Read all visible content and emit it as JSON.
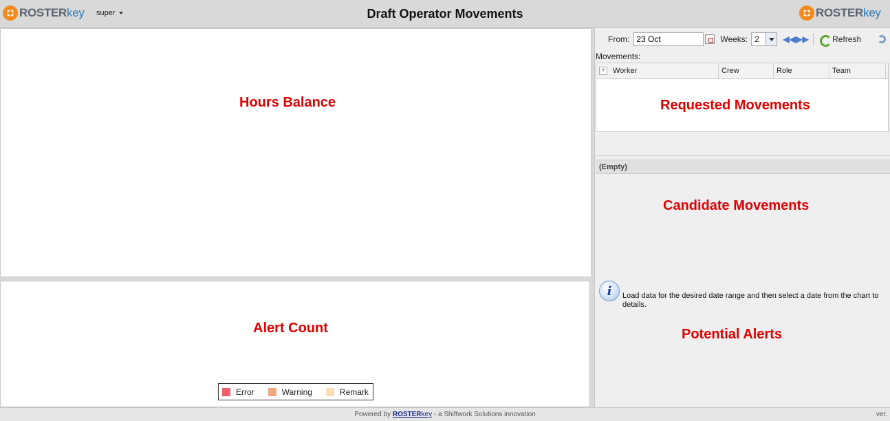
{
  "header": {
    "brand_roster": "ROSTER",
    "brand_key": "key",
    "user": "super",
    "title": "Draft Operator Movements"
  },
  "panels": {
    "hours_balance": "Hours Balance",
    "alert_count": "Alert Count",
    "requested_movements": "Requested Movements",
    "candidate_movements": "Candidate Movements",
    "potential_alerts": "Potential Alerts"
  },
  "legend": [
    {
      "label": "Error",
      "color": "#f0606a"
    },
    {
      "label": "Warning",
      "color": "#f0a882"
    },
    {
      "label": "Remark",
      "color": "#fde0b8"
    }
  ],
  "toolbar": {
    "from_label": "From:",
    "from_value": "23 Oct",
    "weeks_label": "Weeks:",
    "weeks_value": "2",
    "refresh_label": "Refresh"
  },
  "movements": {
    "label": "Movements:",
    "columns": [
      "Worker",
      "Crew",
      "Role",
      "Team"
    ]
  },
  "candidates": {
    "empty_label": "(Empty)"
  },
  "info": {
    "message": "Load data for the desired date range and then select a date from the chart to details."
  },
  "footer": {
    "powered_by": "Powered by",
    "brand_roster": "ROSTER",
    "brand_key": "key",
    "tagline": " - a Shiftwork Solutions innovation",
    "version": "ver."
  },
  "colors": {
    "accent_red": "#e00000",
    "brand_orange": "#f28a1e",
    "brand_blue": "#2f7ab8"
  }
}
